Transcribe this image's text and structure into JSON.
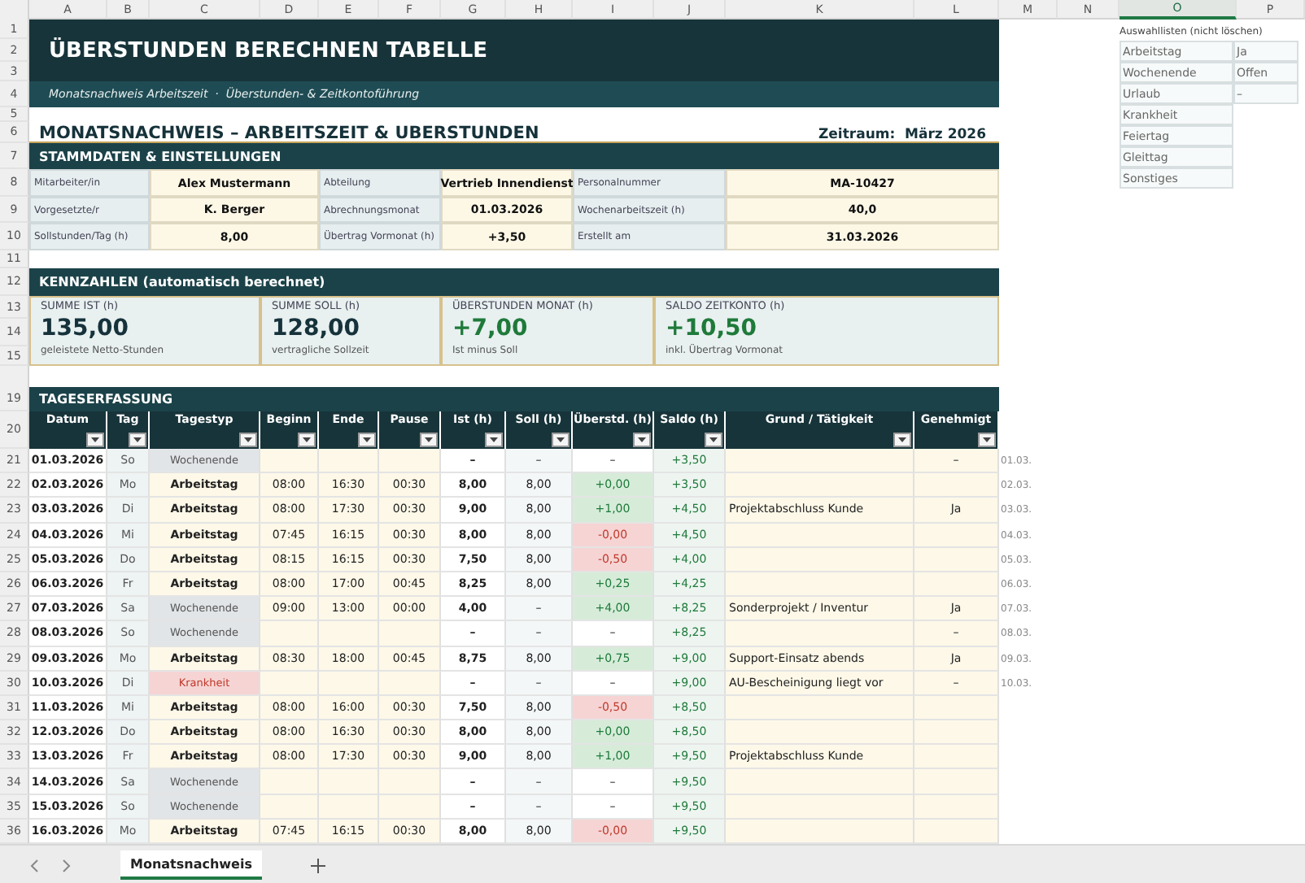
{
  "column_letters": [
    {
      "label": "A",
      "selected": false
    },
    {
      "label": "B",
      "selected": false
    },
    {
      "label": "C",
      "selected": false
    },
    {
      "label": "D",
      "selected": false
    },
    {
      "label": "E",
      "selected": false
    },
    {
      "label": "F",
      "selected": false
    },
    {
      "label": "G",
      "selected": false
    },
    {
      "label": "H",
      "selected": false
    },
    {
      "label": "I",
      "selected": false
    },
    {
      "label": "J",
      "selected": false
    },
    {
      "label": "K",
      "selected": false
    },
    {
      "label": "L",
      "selected": false
    },
    {
      "label": "M",
      "selected": false
    },
    {
      "label": "N",
      "selected": false
    },
    {
      "label": "O",
      "selected": true
    },
    {
      "label": "P",
      "selected": false
    }
  ],
  "row_headers": [
    "1",
    "2",
    "3",
    "4",
    "5",
    "6",
    "7",
    "8",
    "9",
    "10",
    "11",
    "12",
    "13",
    "14",
    "15",
    "19",
    "20",
    "21",
    "22",
    "23",
    "24",
    "25",
    "26",
    "27",
    "28",
    "29",
    "30",
    "31",
    "32",
    "33",
    "34",
    "35",
    "36"
  ],
  "title": "ÜBERSTUNDEN BERECHNEN TABELLE",
  "subtitle": "Monatsnachweis Arbeitszeit  ·  Überstunden- & Zeitkontoführung",
  "heading": "MONATSNACHWEIS – ARBEITSZEIT & UBERSTUNDEN",
  "period": {
    "label": "Zeitraum:",
    "value": "März 2026"
  },
  "master_data": {
    "title": "STAMMDATEN & EINSTELLUNGEN",
    "rows": [
      [
        {
          "label": "Mitarbeiter/in",
          "value": "Alex Mustermann"
        },
        {
          "label": "Abteilung",
          "value": "Vertrieb Innendienst"
        },
        {
          "label": "Personalnummer",
          "value": "MA-10427"
        }
      ],
      [
        {
          "label": "Vorgesetzte/r",
          "value": "K. Berger"
        },
        {
          "label": "Abrechnungsmonat",
          "value": "01.03.2026"
        },
        {
          "label": "Wochenarbeitszeit (h)",
          "value": "40,0"
        }
      ],
      [
        {
          "label": "Sollstunden/Tag (h)",
          "value": "8,00"
        },
        {
          "label": "Übertrag Vormonat (h)",
          "value": "+3,50"
        },
        {
          "label": "Erstellt am",
          "value": "31.03.2026"
        }
      ]
    ]
  },
  "kpis": {
    "title": "KENNZAHLEN (automatisch berechnet)",
    "items": [
      {
        "label": "SUMME IST (h)",
        "value": "135,00",
        "note": "geleistete Netto-Stunden",
        "positive": false
      },
      {
        "label": "SUMME SOLL (h)",
        "value": "128,00",
        "note": "vertragliche Sollzeit",
        "positive": false
      },
      {
        "label": "ÜBERSTUNDEN MONAT (h)",
        "value": "+7,00",
        "note": "Ist minus Soll",
        "positive": true
      },
      {
        "label": "SALDO ZEITKONTO (h)",
        "value": "+10,50",
        "note": "inkl. Übertrag Vormonat",
        "positive": true
      }
    ]
  },
  "day_log": {
    "title": "TAGESERFASSUNG",
    "columns": [
      "Datum",
      "Tag",
      "Tagestyp",
      "Beginn",
      "Ende",
      "Pause",
      "Ist (h)",
      "Soll (h)",
      "Überstd. (h)",
      "Saldo (h)",
      "Grund / Tätigkeit",
      "Genehmigt"
    ],
    "rows": [
      {
        "date": "01.03.2026",
        "weekday": "So",
        "day_type": "Wochenende",
        "kind": "weekend",
        "actual": "–",
        "target": "–",
        "overtime": "–",
        "surplus": false,
        "deficit": false,
        "balance": "+3,50",
        "approved": "–",
        "side_date": "01.03."
      },
      {
        "date": "02.03.2026",
        "weekday": "Mo",
        "day_type": "Arbeitstag",
        "kind": "work",
        "begin": "08:00",
        "end": "16:30",
        "pause": "00:30",
        "actual": "8,00",
        "target": "8,00",
        "overtime": "+0,00",
        "surplus": true,
        "deficit": false,
        "balance": "+3,50",
        "side_date": "02.03."
      },
      {
        "date": "03.03.2026",
        "weekday": "Di",
        "day_type": "Arbeitstag",
        "kind": "work",
        "begin": "08:00",
        "end": "17:30",
        "pause": "00:30",
        "actual": "9,00",
        "target": "8,00",
        "overtime": "+1,00",
        "surplus": true,
        "deficit": false,
        "balance": "+4,50",
        "reason": "Projektabschluss Kunde",
        "approved": "Ja",
        "side_date": "03.03."
      },
      {
        "date": "04.03.2026",
        "weekday": "Mi",
        "day_type": "Arbeitstag",
        "kind": "work",
        "begin": "07:45",
        "end": "16:15",
        "pause": "00:30",
        "actual": "8,00",
        "target": "8,00",
        "overtime": "-0,00",
        "surplus": false,
        "deficit": true,
        "balance": "+4,50",
        "side_date": "04.03."
      },
      {
        "date": "05.03.2026",
        "weekday": "Do",
        "day_type": "Arbeitstag",
        "kind": "work",
        "begin": "08:15",
        "end": "16:15",
        "pause": "00:30",
        "actual": "7,50",
        "target": "8,00",
        "overtime": "-0,50",
        "surplus": false,
        "deficit": true,
        "balance": "+4,00",
        "side_date": "05.03."
      },
      {
        "date": "06.03.2026",
        "weekday": "Fr",
        "day_type": "Arbeitstag",
        "kind": "work",
        "begin": "08:00",
        "end": "17:00",
        "pause": "00:45",
        "actual": "8,25",
        "target": "8,00",
        "overtime": "+0,25",
        "surplus": true,
        "deficit": false,
        "balance": "+4,25",
        "side_date": "06.03."
      },
      {
        "date": "07.03.2026",
        "weekday": "Sa",
        "day_type": "Wochenende",
        "kind": "weekend",
        "begin": "09:00",
        "end": "13:00",
        "pause": "00:00",
        "actual": "4,00",
        "target": "–",
        "overtime": "+4,00",
        "surplus": true,
        "deficit": false,
        "balance": "+8,25",
        "reason": "Sonderprojekt / Inventur",
        "approved": "Ja",
        "side_date": "07.03."
      },
      {
        "date": "08.03.2026",
        "weekday": "So",
        "day_type": "Wochenende",
        "kind": "weekend",
        "actual": "–",
        "target": "–",
        "overtime": "–",
        "surplus": false,
        "deficit": false,
        "balance": "+8,25",
        "approved": "–",
        "side_date": "08.03."
      },
      {
        "date": "09.03.2026",
        "weekday": "Mo",
        "day_type": "Arbeitstag",
        "kind": "work",
        "begin": "08:30",
        "end": "18:00",
        "pause": "00:45",
        "actual": "8,75",
        "target": "8,00",
        "overtime": "+0,75",
        "surplus": true,
        "deficit": false,
        "balance": "+9,00",
        "reason": "Support-Einsatz abends",
        "approved": "Ja",
        "side_date": "09.03."
      },
      {
        "date": "10.03.2026",
        "weekday": "Di",
        "day_type": "Krankheit",
        "kind": "sick",
        "actual": "–",
        "target": "–",
        "overtime": "–",
        "surplus": false,
        "deficit": false,
        "balance": "+9,00",
        "reason": "AU-Bescheinigung liegt vor",
        "approved": "–",
        "side_date": "10.03."
      },
      {
        "date": "11.03.2026",
        "weekday": "Mi",
        "day_type": "Arbeitstag",
        "kind": "work",
        "begin": "08:00",
        "end": "16:00",
        "pause": "00:30",
        "actual": "7,50",
        "target": "8,00",
        "overtime": "-0,50",
        "surplus": false,
        "deficit": true,
        "balance": "+8,50"
      },
      {
        "date": "12.03.2026",
        "weekday": "Do",
        "day_type": "Arbeitstag",
        "kind": "work",
        "begin": "08:00",
        "end": "16:30",
        "pause": "00:30",
        "actual": "8,00",
        "target": "8,00",
        "overtime": "+0,00",
        "surplus": true,
        "deficit": false,
        "balance": "+8,50"
      },
      {
        "date": "13.03.2026",
        "weekday": "Fr",
        "day_type": "Arbeitstag",
        "kind": "work",
        "begin": "08:00",
        "end": "17:30",
        "pause": "00:30",
        "actual": "9,00",
        "target": "8,00",
        "overtime": "+1,00",
        "surplus": true,
        "deficit": false,
        "balance": "+9,50",
        "reason": "Projektabschluss Kunde"
      },
      {
        "date": "14.03.2026",
        "weekday": "Sa",
        "day_type": "Wochenende",
        "kind": "weekend",
        "actual": "–",
        "target": "–",
        "overtime": "–",
        "surplus": false,
        "deficit": false,
        "balance": "+9,50"
      },
      {
        "date": "15.03.2026",
        "weekday": "So",
        "day_type": "Wochenende",
        "kind": "weekend",
        "actual": "–",
        "target": "–",
        "overtime": "–",
        "surplus": false,
        "deficit": false,
        "balance": "+9,50"
      },
      {
        "date": "16.03.2026",
        "weekday": "Mo",
        "day_type": "Arbeitstag",
        "kind": "work",
        "begin": "07:45",
        "end": "16:15",
        "pause": "00:30",
        "actual": "8,00",
        "target": "8,00",
        "overtime": "-0,00",
        "surplus": false,
        "deficit": true,
        "balance": "+9,50"
      }
    ]
  },
  "lists": {
    "title": "Auswahllisten (nicht löschen)",
    "day_types": [
      "Arbeitstag",
      "Wochenende",
      "Urlaub",
      "Krankheit",
      "Feiertag",
      "Gleittag",
      "Sonstiges"
    ],
    "approvals": [
      "Ja",
      "Offen",
      "–"
    ]
  },
  "sheet_tabs": [
    {
      "label": "Monatsnachweis",
      "selected": true
    }
  ]
}
